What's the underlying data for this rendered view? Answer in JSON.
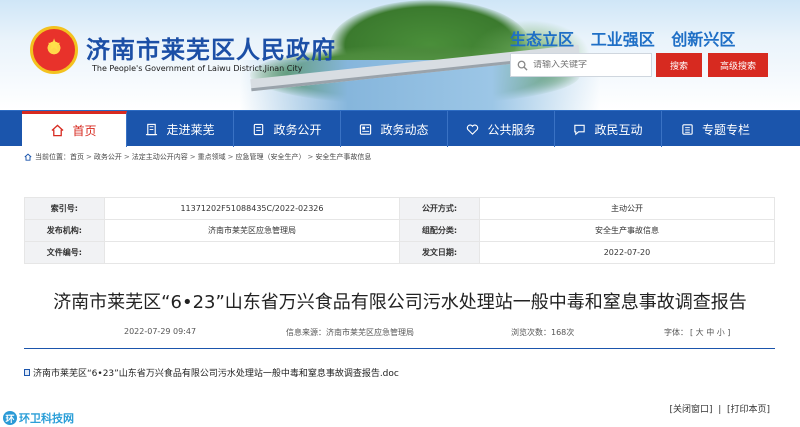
{
  "header": {
    "title": "济南市莱芜区人民政府",
    "subtitle": "The People's Government of Laiwu District,Jinan City",
    "slogan": "生态立区   工业强区   创新兴区",
    "search_placeholder": "请输入关键字",
    "search_button": "搜索",
    "advanced_search_button": "高级搜索"
  },
  "nav": {
    "items": [
      {
        "label": "首页",
        "icon": "home-icon"
      },
      {
        "label": "走进莱芜",
        "icon": "building-icon"
      },
      {
        "label": "政务公开",
        "icon": "document-icon"
      },
      {
        "label": "政务动态",
        "icon": "news-icon"
      },
      {
        "label": "公共服务",
        "icon": "heart-hand-icon"
      },
      {
        "label": "政民互动",
        "icon": "chat-icon"
      },
      {
        "label": "专题专栏",
        "icon": "list-icon"
      }
    ]
  },
  "breadcrumb": {
    "prefix": "当前位置：",
    "items": [
      "首页",
      "政务公开",
      "法定主动公开内容",
      "重点领域",
      "应急管理（安全生产）",
      "安全生产事故信息"
    ]
  },
  "meta": {
    "index_label": "索引号:",
    "index_value": "11371202F51088435C/2022-02326",
    "disclosure_label": "公开方式:",
    "disclosure_value": "主动公开",
    "publisher_label": "发布机构:",
    "publisher_value": "济南市莱芜区应急管理局",
    "category_label": "组配分类:",
    "category_value": "安全生产事故信息",
    "doc_no_label": "文件编号:",
    "doc_no_value": "",
    "date_label": "发文日期:",
    "date_value": "2022-07-20"
  },
  "article": {
    "title": "济南市莱芜区“6•23”山东省万兴食品有限公司污水处理站一般中毒和窒息事故调查报告",
    "datetime": "2022-07-29 09:47",
    "source": "信息来源：济南市莱芜区应急管理局",
    "views": "浏览次数：168次",
    "font_label": "字体：",
    "font_options": "[ 大  中  小 ]",
    "attachment": "济南市莱芜区“6•23”山东省万兴食品有限公司污水处理站一般中毒和窒息事故调查报告.doc"
  },
  "footer": {
    "links": "[关闭窗口]  |  [打印本页]"
  },
  "watermark": {
    "text": "环卫科技网"
  },
  "colors": {
    "nav_blue": "#1b55ac",
    "accent_red": "#d72a20",
    "title_blue": "#1c4fa6"
  }
}
